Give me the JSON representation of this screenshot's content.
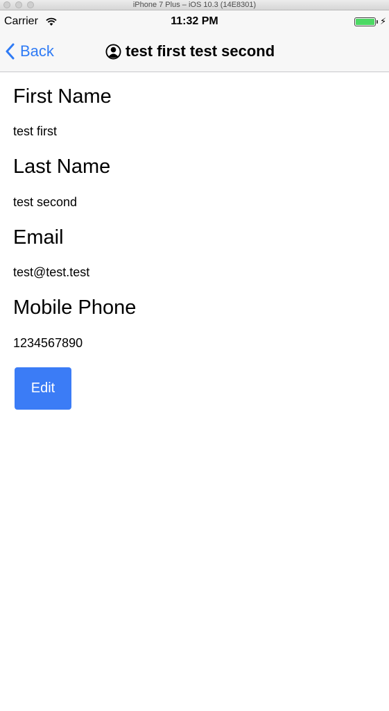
{
  "simulator": {
    "window_title": "iPhone 7 Plus – iOS 10.3 (14E8301)"
  },
  "status_bar": {
    "carrier": "Carrier",
    "time": "11:32 PM",
    "battery_color": "#4cd964"
  },
  "navbar": {
    "back_label": "Back",
    "title": "test first test second",
    "accent_color": "#2f7bf5"
  },
  "fields": [
    {
      "label": "First Name",
      "value": "test first"
    },
    {
      "label": "Last Name",
      "value": "test second"
    },
    {
      "label": "Email",
      "value": "test@test.test"
    },
    {
      "label": "Mobile Phone",
      "value": "1234567890"
    }
  ],
  "actions": {
    "edit_label": "Edit",
    "button_color": "#3b7cf6"
  }
}
